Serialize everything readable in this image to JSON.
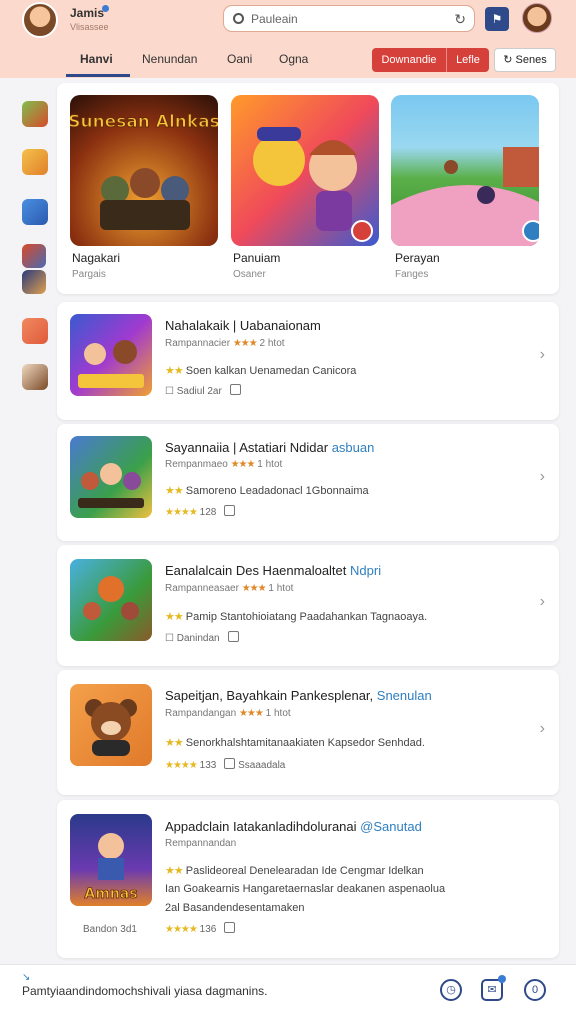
{
  "header": {
    "user_name": "Jamis",
    "user_sub": "Vlisassee",
    "search_value": "Pauleain",
    "tabs": [
      "Hanvi",
      "Nenundan",
      "Oani",
      "Ogna"
    ],
    "download_label": "Downandie",
    "like_label": "Lefle",
    "share_label": "Senes",
    "share_icon": "↻"
  },
  "featured": [
    {
      "title": "Nagakari",
      "sub": "Pargais",
      "art": "Sunesan Alnkas"
    },
    {
      "title": "Panuiam",
      "sub": "Osaner"
    },
    {
      "title": "Perayan",
      "sub": "Fanges"
    }
  ],
  "list": [
    {
      "title": "Nahalakaik | Uabanaionam",
      "meta": "Rampannacier",
      "stars": "★★★",
      "count": "2 htot",
      "desc": "Soen kalkan Uenamedan Canicora",
      "foot": "Sadiul 2ar",
      "chevron": "›"
    },
    {
      "title": "Sayannaiia | Astatiari Ndidar",
      "title_accent": "asbuan",
      "meta": "Rempanmaeo",
      "stars": "★★★",
      "count": "1 htot",
      "desc": "Samoreno Leadadonacl 1Gbonnaima",
      "foot_stars": "★★★★",
      "foot": "128",
      "chevron": "›"
    },
    {
      "title": "Eanalalcain Des Haenmaloaltet",
      "title_accent": "Ndpri",
      "meta": "Rampanneasaer",
      "stars": "★★★",
      "count": "1 htot",
      "desc": "Pamip Stantohioiatang Paadahankan Tagnaoaya.",
      "foot": "Danindan",
      "chevron": "›"
    },
    {
      "title": "Sapeitjan, Bayahkain Pankesplenar,",
      "title_accent": "Snenulan",
      "meta": "Rampandangan",
      "stars": "★★★",
      "count": "1 htot",
      "desc": "Senorkhalshtamitanaakiaten Kapsedor Senhdad.",
      "foot_stars": "★★★★",
      "foot": "133",
      "foot2": "Ssaaadala",
      "chevron": "›"
    },
    {
      "title": "Appadclain Iatakanladihdoluranai",
      "title_accent": "@Sanutad",
      "meta": "Rempannandan",
      "desc1": "Paslideoreal Denelearadan Ide Cengmar Idelkan",
      "desc2": "Ian Goakearnis Hangaretaernaslar deakanen aspenaolua",
      "desc3": "2al Basandendesentamaken",
      "side": "Bandon 3d1",
      "foot_stars": "★★★★",
      "foot": "136",
      "art": "Amnas"
    }
  ],
  "bottom": {
    "text": "Pamtyiaandindomochshivali yiasa dagmanins.",
    "mark": "↘",
    "icons": [
      "clock-icon",
      "chat-icon",
      "info-icon"
    ]
  },
  "colors": {
    "header_bg": "#fbd9cc",
    "accent_blue": "#2f4a8a",
    "accent_red": "#d6403a",
    "link_blue": "#2f7fc1",
    "star_orange": "#e0892a"
  }
}
